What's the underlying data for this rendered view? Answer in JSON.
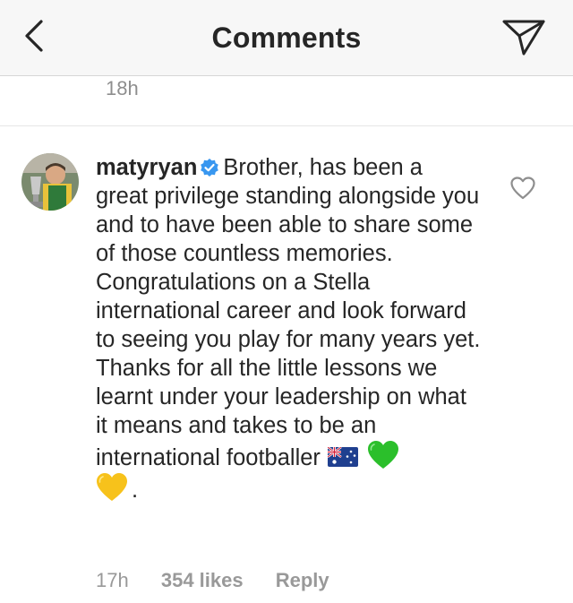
{
  "header": {
    "title": "Comments",
    "back_icon": "chevron-left-icon",
    "share_icon": "paper-plane-icon"
  },
  "previous_comment": {
    "time": "18h"
  },
  "comment": {
    "username": "matyryan",
    "verified": true,
    "text_main": "Brother, has been a great privilege standing alongside you and to have been able to share some of those countless memories. Congratulations on a Stella international career and look forward to seeing you play for many years yet. Thanks for all the little lessons we learnt under your leadership on what it means and takes to be an international footballer",
    "text_end": ".",
    "emojis": [
      "australia-flag",
      "green-heart",
      "yellow-heart"
    ],
    "time": "17h",
    "likes": "354 likes",
    "reply_label": "Reply",
    "like_icon": "heart-outline-icon"
  },
  "colors": {
    "verified_blue": "#3897f0",
    "meta_gray": "#999999",
    "header_bg": "#f7f7f7"
  }
}
